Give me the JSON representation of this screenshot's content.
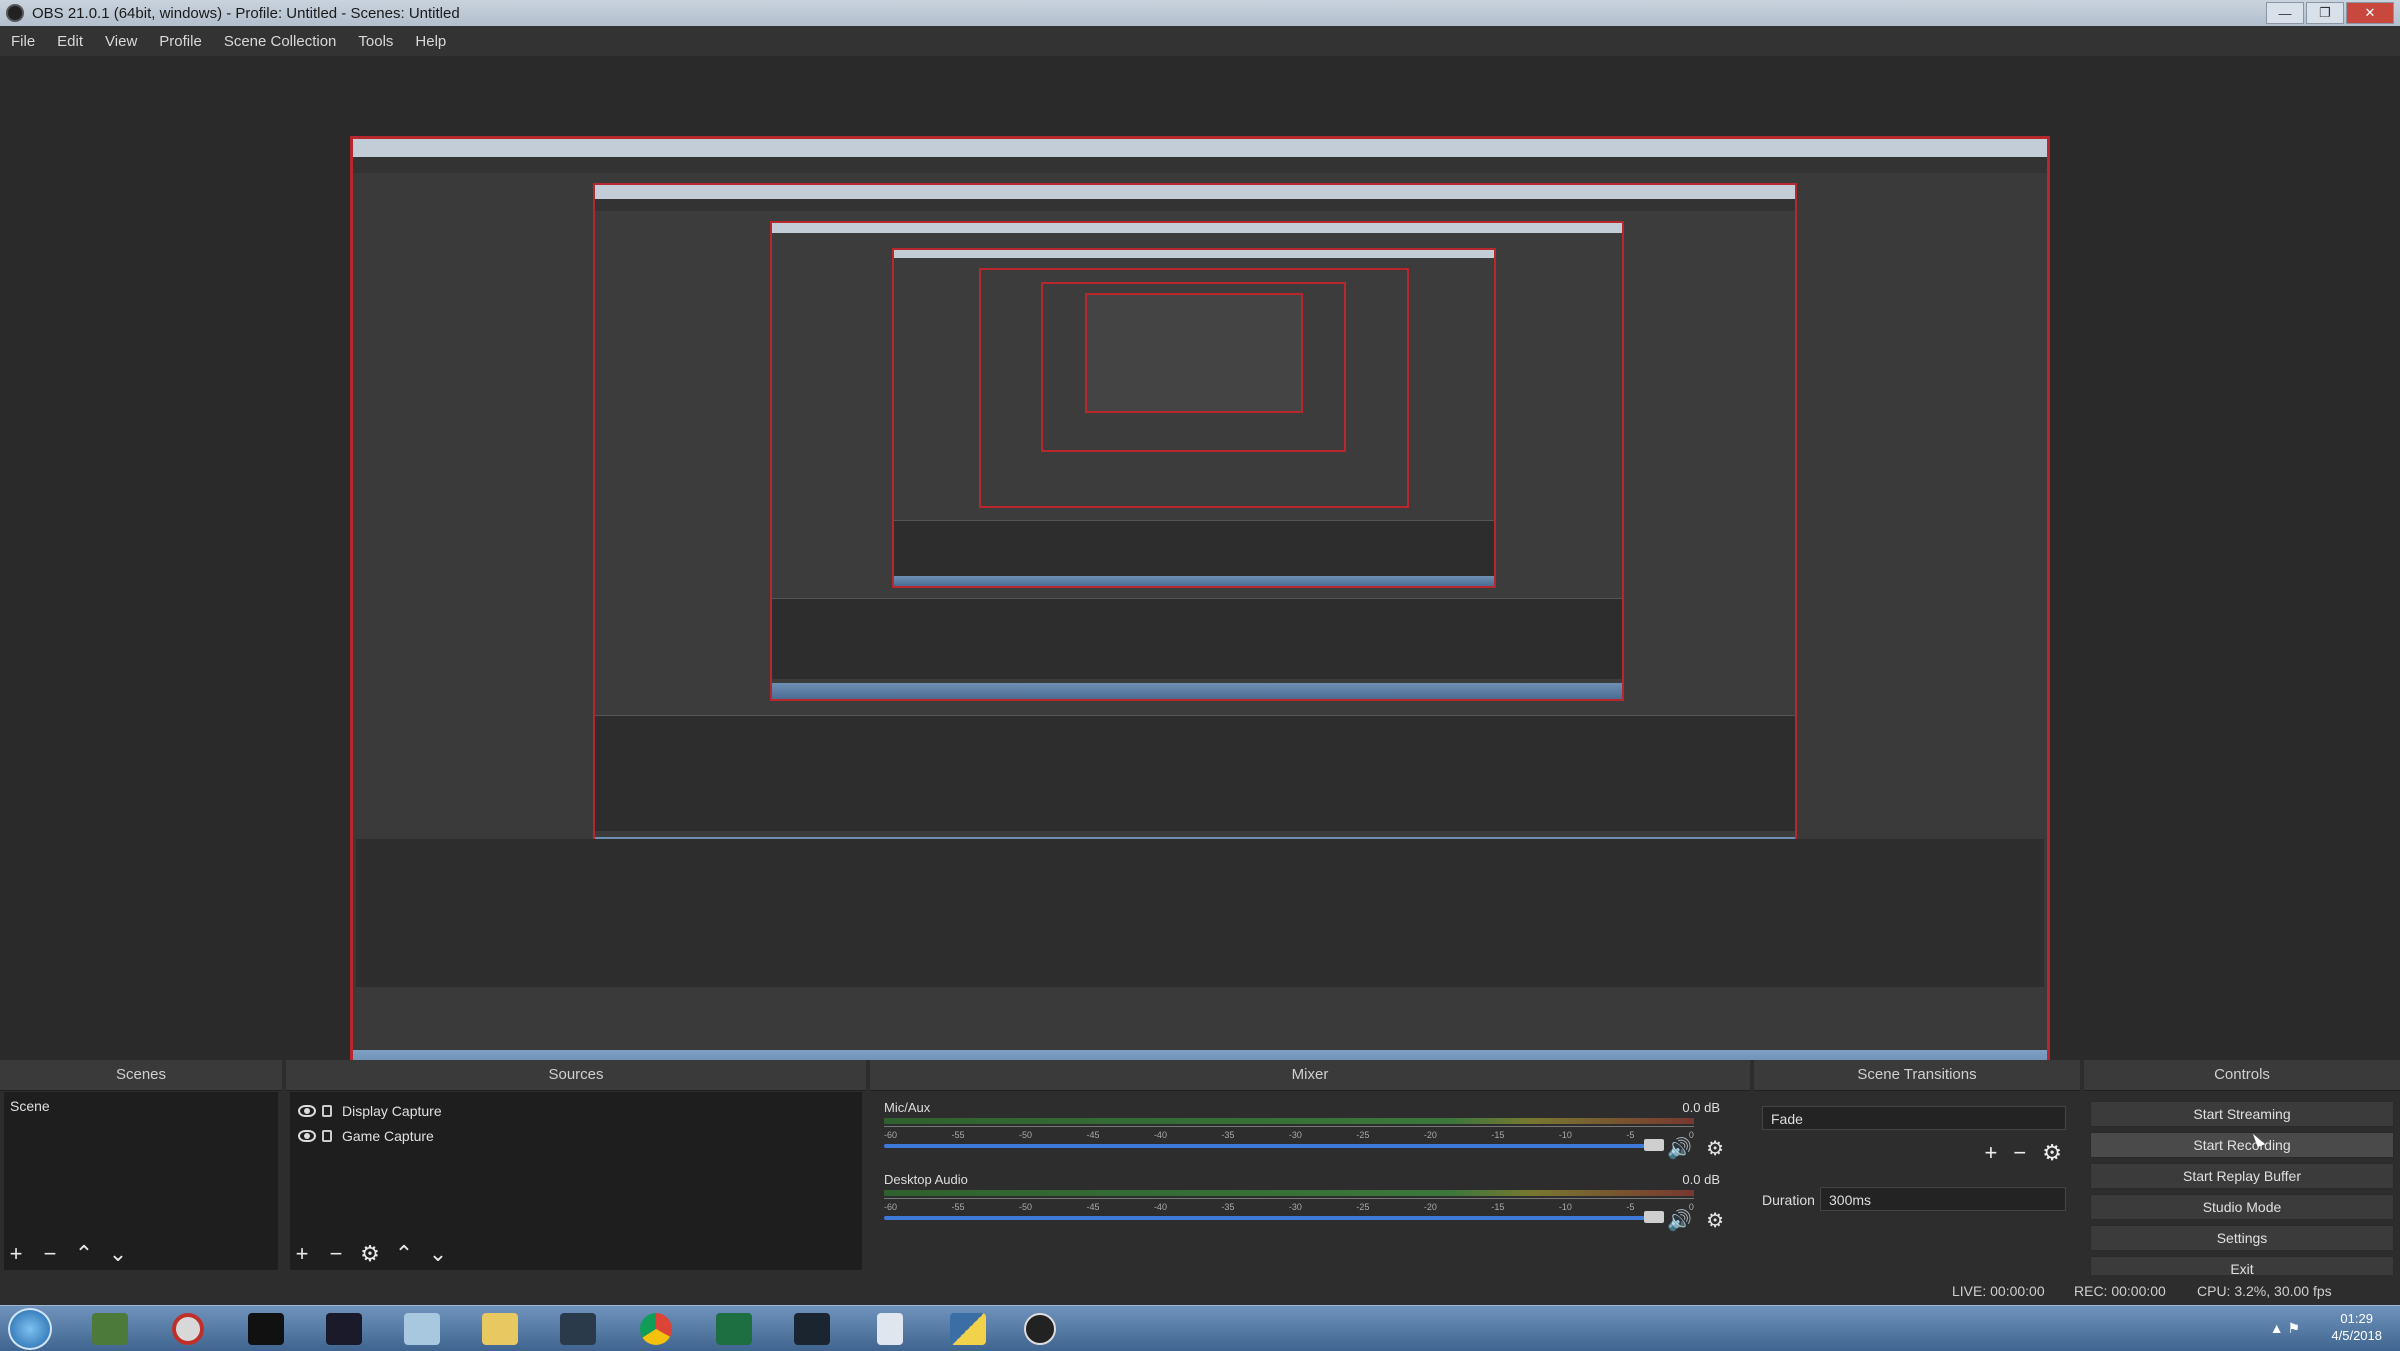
{
  "window": {
    "title": "OBS 21.0.1 (64bit, windows) - Profile: Untitled - Scenes: Untitled",
    "minimize": "—",
    "maximize": "❐",
    "close": "✕"
  },
  "menu": [
    "File",
    "Edit",
    "View",
    "Profile",
    "Scene Collection",
    "Tools",
    "Help"
  ],
  "docks": {
    "scenes": {
      "title": "Scenes",
      "items": [
        "Scene"
      ]
    },
    "sources": {
      "title": "Sources",
      "items": [
        "Display Capture",
        "Game Capture"
      ]
    },
    "mixer": {
      "title": "Mixer",
      "channels": [
        {
          "name": "Mic/Aux",
          "db": "0.0 dB",
          "volume_percent": 100
        },
        {
          "name": "Desktop Audio",
          "db": "0.0 dB",
          "volume_percent": 100
        }
      ],
      "ticks": [
        "-60",
        "-55",
        "-50",
        "-45",
        "-40",
        "-35",
        "-30",
        "-25",
        "-20",
        "-15",
        "-10",
        "-5",
        "0"
      ]
    },
    "transitions": {
      "title": "Scene Transitions",
      "selected": "Fade",
      "duration_label": "Duration",
      "duration_value": "300ms"
    },
    "controls": {
      "title": "Controls",
      "buttons": [
        "Start Streaming",
        "Start Recording",
        "Start Replay Buffer",
        "Studio Mode",
        "Settings",
        "Exit"
      ]
    }
  },
  "status": {
    "live": "LIVE: 00:00:00",
    "rec": "REC: 00:00:00",
    "cpu": "CPU: 3.2%, 30.00 fps"
  },
  "taskbar": {
    "time": "01:29",
    "date": "4/5/2018",
    "apps": [
      "firefox-icon",
      "minecraft-icon",
      "opera-icon",
      "terminal-icon",
      "ninja-icon",
      "notepad-icon",
      "folder-icon",
      "eve-icon",
      "chrome-icon",
      "excel-icon",
      "eve-online-icon",
      "document-icon",
      "python-icon",
      "obs-icon"
    ]
  }
}
